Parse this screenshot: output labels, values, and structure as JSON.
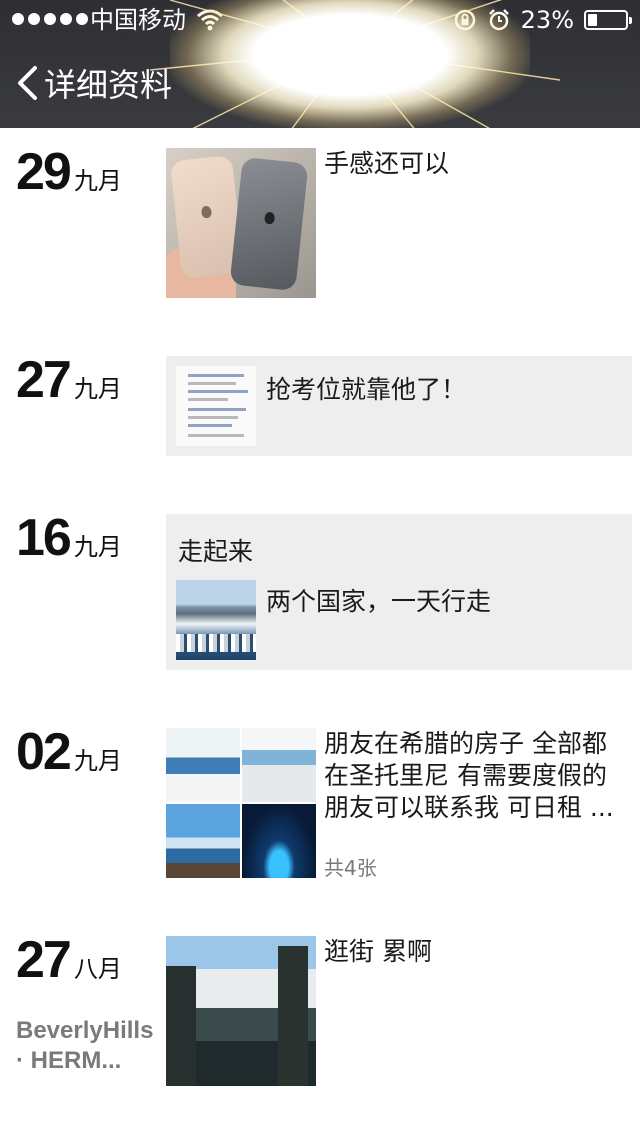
{
  "status_bar": {
    "carrier": "中国移动",
    "battery": "23%",
    "icons": [
      "signal-dots-icon",
      "wifi-icon",
      "rotation-lock-icon",
      "alarm-icon",
      "battery-icon"
    ]
  },
  "nav": {
    "back_label": "详细资料",
    "back_icon": "chevron-left-icon"
  },
  "colors": {
    "header_bg": "#2e2f33",
    "share_card_bg": "#eeeeef",
    "secondary_text": "#7a7a7a"
  },
  "posts": [
    {
      "day": "29",
      "month": "九月",
      "caption": "手感还可以",
      "image": "two-phones-photo"
    },
    {
      "day": "27",
      "month": "九月",
      "share_text": "抢考位就靠他了！",
      "image": "chat-screenshot-thumbnail"
    },
    {
      "day": "16",
      "month": "九月",
      "caption": "走起来",
      "share_text": "两个国家，一天行走",
      "image": "harbor-photo"
    },
    {
      "day": "02",
      "month": "九月",
      "caption": "朋友在希腊的房子 全部都在圣托里尼 有需要度假的朋友可以联系我 可日租 ...",
      "count": "共4张",
      "image": "house-photo-grid"
    },
    {
      "day": "27",
      "month": "八月",
      "caption": "逛街 累啊",
      "location": "BeverlyHills · HERM...",
      "image": "street-photo"
    }
  ]
}
